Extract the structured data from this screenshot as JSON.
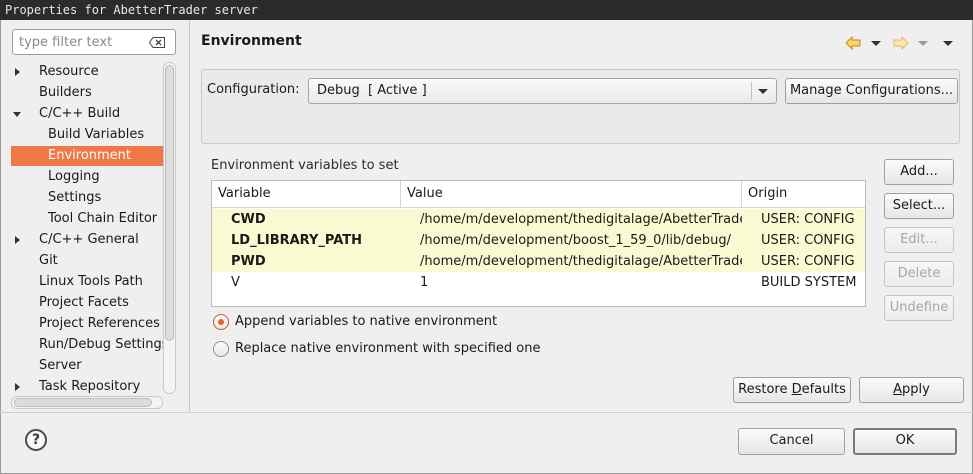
{
  "window": {
    "title": "Properties for AbetterTrader server"
  },
  "filter": {
    "placeholder": "type filter text"
  },
  "tree": {
    "items": [
      {
        "label": "Resource",
        "expander": "right"
      },
      {
        "label": "Builders",
        "expander": ""
      },
      {
        "label": "C/C++ Build",
        "expander": "down"
      },
      {
        "label": "Build Variables",
        "expander": "",
        "child": true
      },
      {
        "label": "Environment",
        "expander": "",
        "child": true,
        "selected": true
      },
      {
        "label": "Logging",
        "expander": "",
        "child": true
      },
      {
        "label": "Settings",
        "expander": "",
        "child": true
      },
      {
        "label": "Tool Chain Editor",
        "expander": "",
        "child": true
      },
      {
        "label": "C/C++ General",
        "expander": "right"
      },
      {
        "label": "Git",
        "expander": ""
      },
      {
        "label": "Linux Tools Path",
        "expander": ""
      },
      {
        "label": "Project Facets",
        "expander": ""
      },
      {
        "label": "Project References",
        "expander": ""
      },
      {
        "label": "Run/Debug Settings",
        "expander": ""
      },
      {
        "label": "Server",
        "expander": ""
      },
      {
        "label": "Task Repository",
        "expander": "right"
      }
    ]
  },
  "page": {
    "title": "Environment",
    "config_label": "Configuration:",
    "config_value": "Debug  [ Active ]",
    "manage_button": "Manage Configurations...",
    "vars_label": "Environment variables to set",
    "columns": [
      "Variable",
      "Value",
      "Origin"
    ],
    "rows": [
      {
        "variable": "CWD",
        "value": "/home/m/development/thedigitalage/AbetterTrader/server/Debug",
        "origin": "USER: CONFIG",
        "user": true
      },
      {
        "variable": "LD_LIBRARY_PATH",
        "value": "/home/m/development/boost_1_59_0/lib/debug/",
        "origin": "USER: CONFIG",
        "user": true
      },
      {
        "variable": "PWD",
        "value": "/home/m/development/thedigitalage/AbetterTrader/server/Debug",
        "origin": "USER: CONFIG",
        "user": true
      },
      {
        "variable": "V",
        "value": "1",
        "origin": "BUILD SYSTEM",
        "user": false
      }
    ],
    "side_buttons": [
      {
        "label": "Add...",
        "enabled": true
      },
      {
        "label": "Select...",
        "enabled": true
      },
      {
        "label": "Edit...",
        "enabled": false
      },
      {
        "label": "Delete",
        "enabled": false
      },
      {
        "label": "Undefine",
        "enabled": false
      }
    ],
    "radio_append": "Append variables to native environment",
    "radio_replace": "Replace native environment with specified one",
    "selected_radio": "append",
    "restore_pre": "Restore ",
    "restore_mnemonic": "D",
    "restore_post": "efaults",
    "apply_mnemonic": "A",
    "apply_post": "pply"
  },
  "footer": {
    "cancel": "Cancel",
    "ok": "OK",
    "help": "?"
  },
  "colors": {
    "selection": "#f07746",
    "user_row": "#fafad2",
    "nav_arrow": "#f5a623"
  }
}
